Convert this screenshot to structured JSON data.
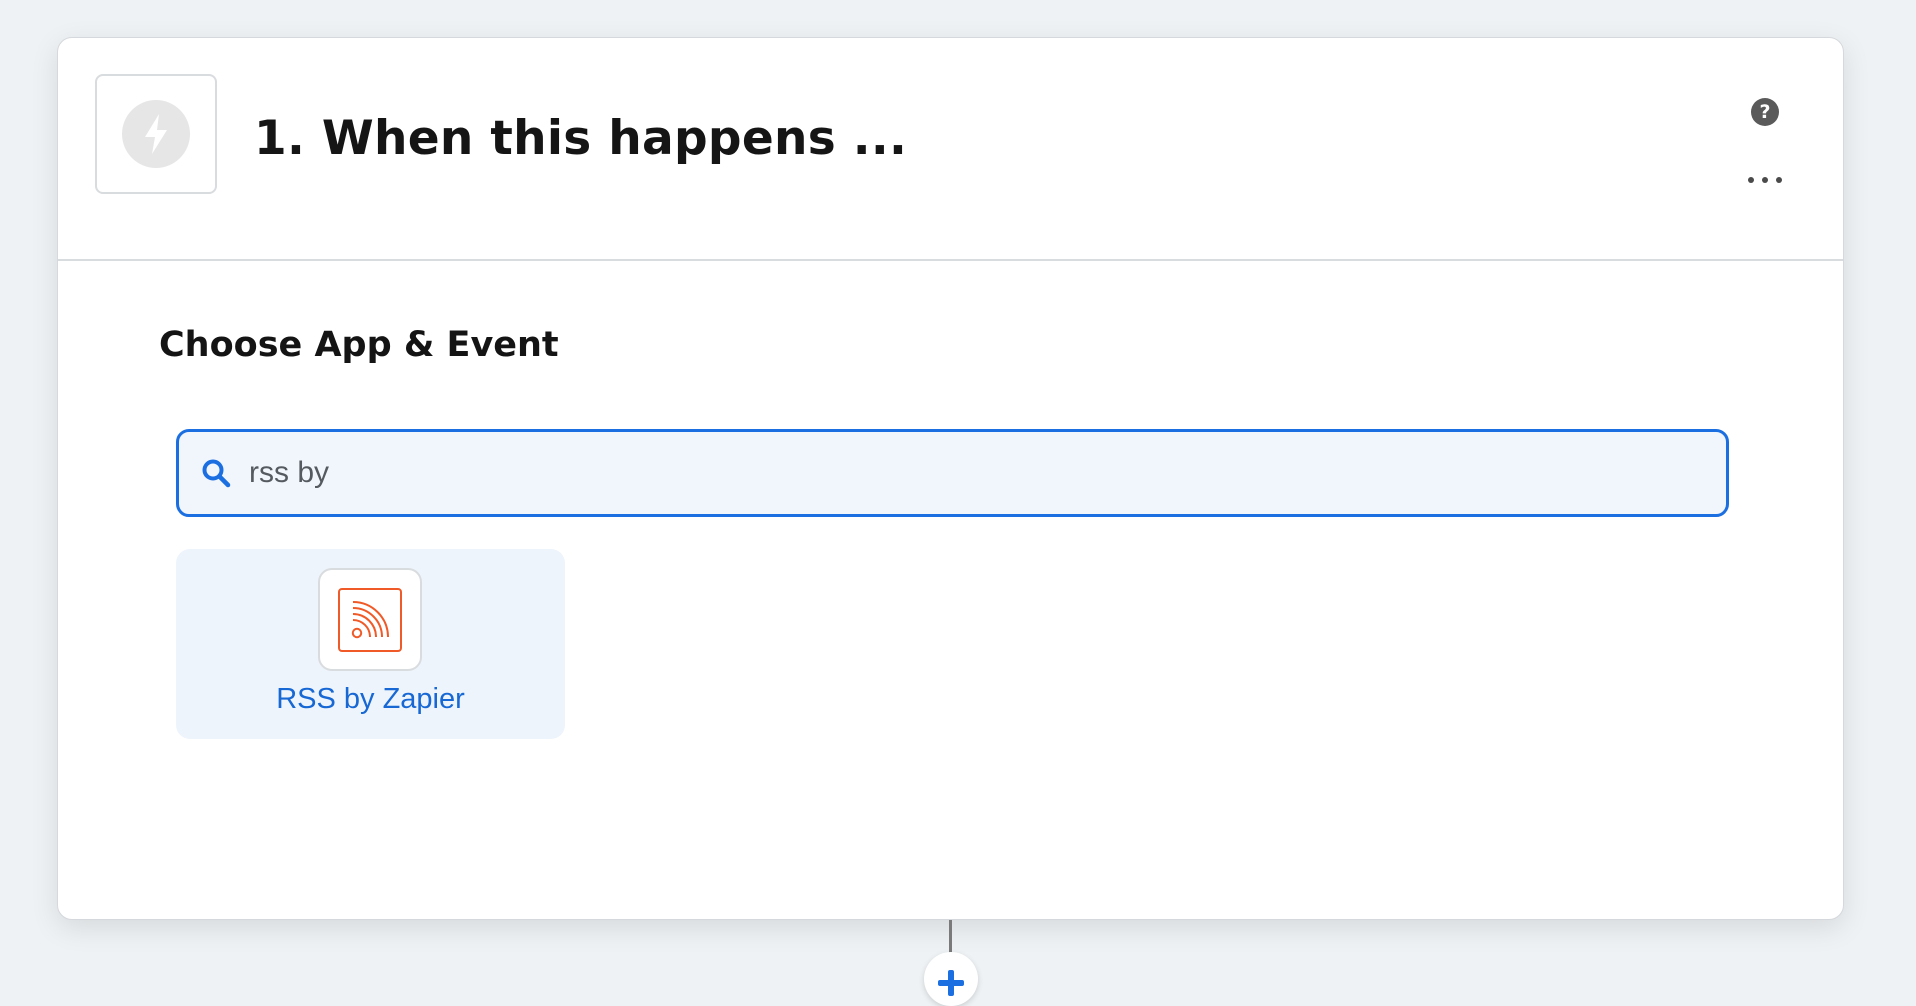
{
  "step": {
    "title": "1. When this happens ...",
    "trigger_icon": "lightning-bolt-icon",
    "help_icon": "question-circle-icon",
    "help_glyph": "?",
    "more_icon": "ellipsis-icon"
  },
  "section": {
    "title": "Choose App & Event"
  },
  "search": {
    "value": "rss by",
    "icon": "search-icon"
  },
  "results": [
    {
      "label": "RSS by Zapier",
      "icon": "rss-icon"
    }
  ],
  "colors": {
    "accent": "#1c6fe0",
    "link": "#1768d4",
    "rss_orange": "#f05a28",
    "background": "#eef2f4"
  },
  "add_step_icon": "plus-icon"
}
